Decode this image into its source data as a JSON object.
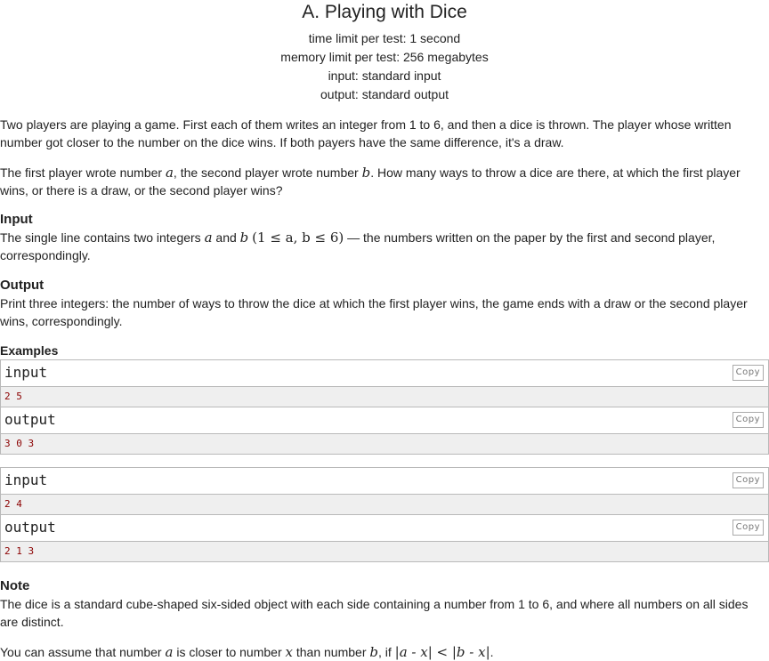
{
  "problem": {
    "title": "A. Playing with Dice",
    "time_limit": "time limit per test: 1 second",
    "memory_limit": "memory limit per test: 256 megabytes",
    "input_file": "input: standard input",
    "output_file": "output: standard output"
  },
  "statement": {
    "p1": "Two players are playing a game. First each of them writes an integer from 1 to 6, and then a dice is thrown. The player whose written number got closer to the number on the dice wins. If both payers have the same difference, it's a draw.",
    "p2_a": "The first player wrote number ",
    "p2_var_a": "a",
    "p2_b": ", the second player wrote number ",
    "p2_var_b": "b",
    "p2_c": ". How many ways to throw a dice are there, at which the first player wins, or there is a draw, or the second player wins?"
  },
  "input_section": {
    "title": "Input",
    "t1": "The single line contains two integers ",
    "var_a": "a",
    "t2": " and ",
    "var_b": "b",
    "constraint": "(1 ≤ a, b ≤ 6)",
    "t3": " — the numbers written on the paper by the first and second player, correspondingly."
  },
  "output_section": {
    "title": "Output",
    "text": "Print three integers: the number of ways to throw the dice at which the first player wins, the game ends with a draw or the second player wins, correspondingly."
  },
  "examples": {
    "title": "Examples",
    "copy_label": "Copy",
    "input_label": "input",
    "output_label": "output",
    "items": [
      {
        "input": "2 5",
        "output": "3 0 3"
      },
      {
        "input": "2 4",
        "output": "2 1 3"
      }
    ]
  },
  "note": {
    "title": "Note",
    "p1": "The dice is a standard cube-shaped six-sided object with each side containing a number from 1 to 6, and where all numbers on all sides are distinct.",
    "p2_a": "You can assume that number ",
    "var_a": "a",
    "p2_b": " is closer to number ",
    "var_x": "x",
    "p2_c": " than number ",
    "var_b": "b",
    "p2_d": ", if ",
    "formula": "|a - x| < |b - x|",
    "p2_e": "."
  }
}
